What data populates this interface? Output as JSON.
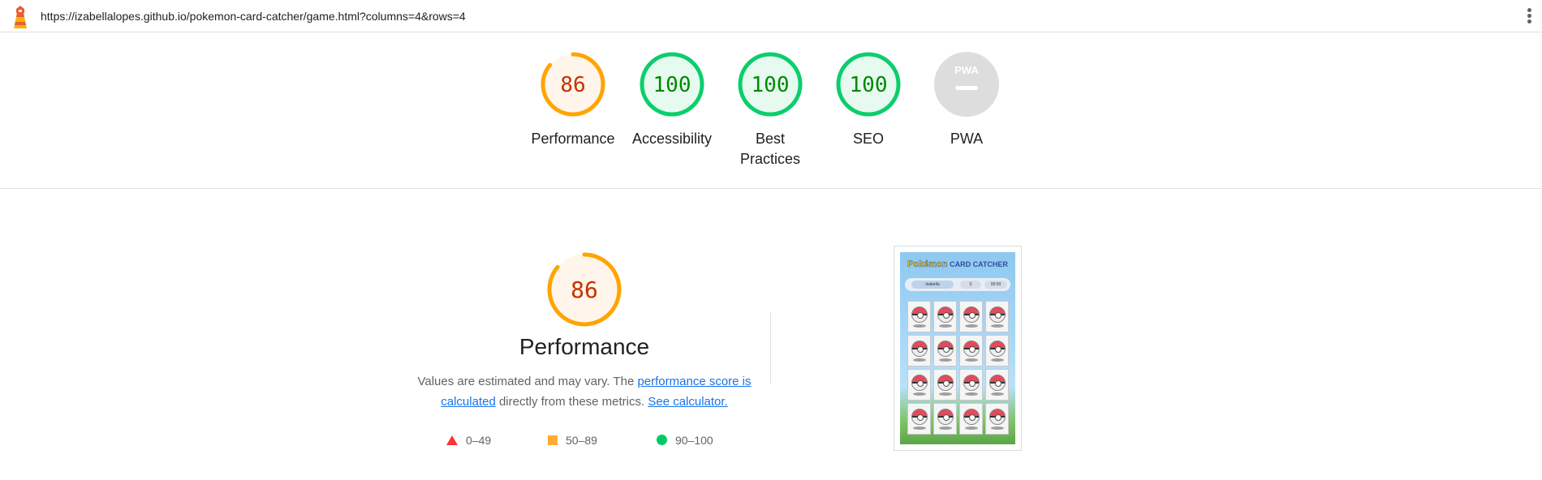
{
  "topbar": {
    "url": "https://izabellalopes.github.io/pokemon-card-catcher/game.html?columns=4&rows=4",
    "logo_icon": "lighthouse-icon",
    "menu_icon": "more-vert-icon"
  },
  "colors": {
    "average": "#ffa400",
    "average_text": "#c33300",
    "average_fill": "#fff5eb",
    "pass": "#0cce6b",
    "pass_text": "#008800",
    "pass_fill": "#e6faf0",
    "na": "#dddddd"
  },
  "scores": [
    {
      "label": "Performance",
      "value": "86",
      "rating": "average",
      "fraction": 0.86
    },
    {
      "label": "Accessibility",
      "value": "100",
      "rating": "pass",
      "fraction": 1.0
    },
    {
      "label": "Best Practices",
      "value": "100",
      "rating": "pass",
      "fraction": 1.0
    },
    {
      "label": "SEO",
      "value": "100",
      "rating": "pass",
      "fraction": 1.0
    },
    {
      "label": "PWA",
      "value": "",
      "rating": "na",
      "badge": "PWA"
    }
  ],
  "performance": {
    "score": "86",
    "fraction": 0.86,
    "title": "Performance",
    "desc_prefix": "Values are estimated and may vary. The ",
    "score_link": "performance score is calculated",
    "desc_middle": " directly from these metrics. ",
    "calc_link": "See calculator."
  },
  "legend": [
    {
      "range": "0–49",
      "shape": "triangle",
      "color": "#ff3333"
    },
    {
      "range": "50–89",
      "shape": "square",
      "color": "#ffaa33"
    },
    {
      "range": "90–100",
      "shape": "circle",
      "color": "#00cc66"
    }
  ],
  "screenshot": {
    "logo_word": "Pokémon",
    "logo_sub": "CARD CATCHER",
    "player": "Isabella",
    "count": "0",
    "time": "00:00",
    "cards": 16
  }
}
